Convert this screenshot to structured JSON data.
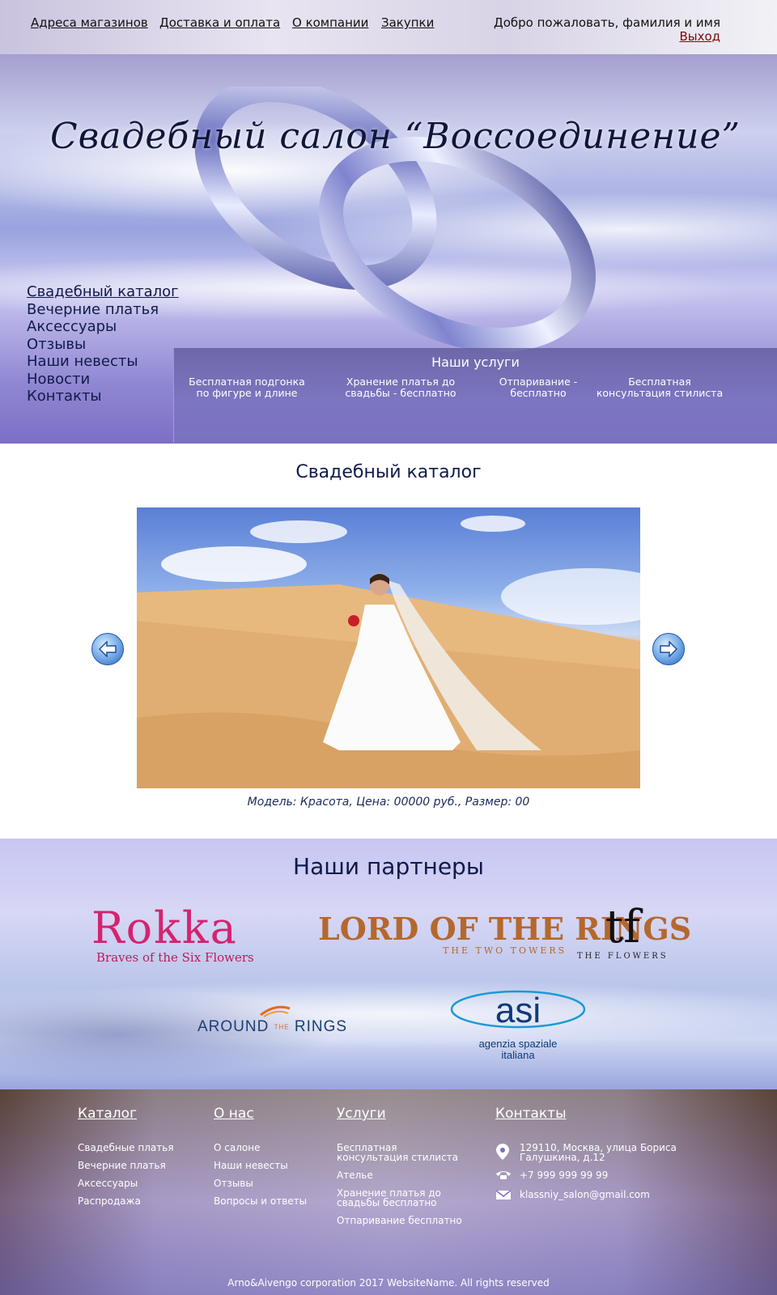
{
  "topnav": {
    "links": [
      "Адреса магазинов",
      "Доставка и оплата",
      "О компании",
      "Закупки"
    ],
    "welcome": "Добро пожаловать, фамилия и имя",
    "logout": "Выход"
  },
  "hero": {
    "title": "Свадебный салон “Воссоединение”",
    "menu": [
      "Свадебный каталог",
      "Вечерние платья",
      "Аксессуары",
      "Отзывы",
      "Наши невесты",
      "Новости",
      "Контакты"
    ],
    "services_title": "Наши услуги",
    "services": [
      [
        "Бесплатная подгонка",
        "по фигуре и длине"
      ],
      [
        "Хранение платья до",
        "свадьбы - бесплатно"
      ],
      [
        "Отпаривание -",
        "бесплатно"
      ],
      [
        "Бесплатная",
        "консультация стилиста"
      ]
    ]
  },
  "catalog": {
    "title": "Свадебный каталог",
    "caption": "Модель: Красота, Цена: 00000 руб., Размер: 00"
  },
  "partners": {
    "title": "Наши партнеры",
    "rokka": {
      "big": "Rokka",
      "small": "Braves of the Six Flowers"
    },
    "lotr": {
      "big": "LORD OF THE RINGS",
      "small": "THE TWO TOWERS"
    },
    "tf": {
      "mark": "tf",
      "small": "THE FLOWERS"
    },
    "around": {
      "pre": "AROUND",
      "the": "THE",
      "post": "RINGS"
    },
    "asi": {
      "mark": "asi",
      "name": [
        "agenzia spaziale",
        "italiana"
      ]
    }
  },
  "footer": {
    "catalog": {
      "title": "Каталог",
      "items": [
        "Свадебные платья",
        "Вечерние платья",
        "Аксессуары",
        "Распродажа"
      ]
    },
    "about": {
      "title": "О нас",
      "items": [
        "О салоне",
        "Наши невесты",
        "Отзывы",
        "Вопросы и ответы"
      ]
    },
    "services": {
      "title": "Услуги",
      "items": [
        [
          "Бесплатная",
          "консультация стилиста"
        ],
        [
          "Ателье"
        ],
        [
          "Хранение платья до",
          "свадьбы бесплатно"
        ],
        [
          "Отпаривание бесплатно"
        ]
      ]
    },
    "contacts": {
      "title": "Контакты",
      "address": [
        "129110, Москва, улица Бориса",
        "Галушкина, д.12"
      ],
      "phone": "+7 999 999 99 99",
      "email": "klassniy_salon@gmail.com"
    },
    "copyright": "Arno&Aivengo corporation 2017 WebsiteName. All rights reserved"
  }
}
